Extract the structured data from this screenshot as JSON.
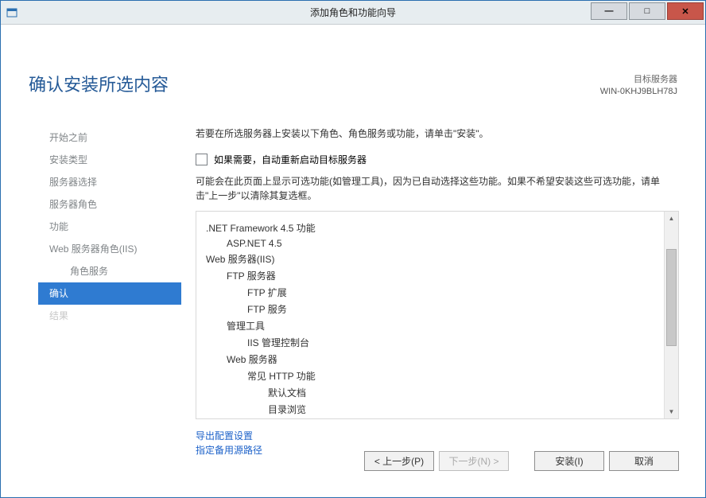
{
  "titlebar": {
    "title": "添加角色和功能向导"
  },
  "page": {
    "heading": "确认安装所选内容",
    "target_label": "目标服务器",
    "target_server": "WIN-0KHJ9BLH78J"
  },
  "steps": {
    "before": "开始之前",
    "type": "安装类型",
    "server": "服务器选择",
    "roles": "服务器角色",
    "feat": "功能",
    "iis": "Web 服务器角色(IIS)",
    "rolesvc": "角色服务",
    "confirm": "确认",
    "result": "结果"
  },
  "content": {
    "intro": "若要在所选服务器上安装以下角色、角色服务或功能，请单击\"安装\"。",
    "restart_checkbox": "如果需要，自动重新启动目标服务器",
    "desc": "可能会在此页面上显示可选功能(如管理工具)，因为已自动选择这些功能。如果不希望安装这些可选功能，请单击\"上一步\"以清除其复选框。"
  },
  "features": {
    "dotnet": ".NET Framework 4.5 功能",
    "aspnet": "ASP.NET 4.5",
    "webiis": "Web 服务器(IIS)",
    "ftp": "FTP 服务器",
    "ftpext": "FTP 扩展",
    "ftpsvc": "FTP 服务",
    "mgmt": "管理工具",
    "console": "IIS 管理控制台",
    "websrv": "Web 服务器",
    "http": "常见 HTTP 功能",
    "defdoc": "默认文档",
    "dirbrowse": "目录浏览"
  },
  "links": {
    "export": "导出配置设置",
    "altpath": "指定备用源路径"
  },
  "buttons": {
    "prev": "< 上一步(P)",
    "next": "下一步(N) >",
    "install": "安装(I)",
    "cancel": "取消"
  }
}
